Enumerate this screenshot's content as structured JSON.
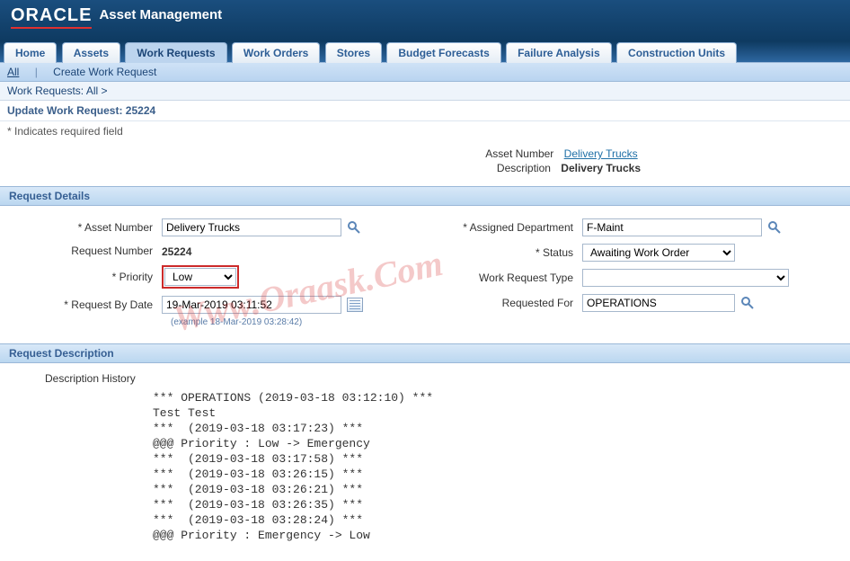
{
  "header": {
    "logo": "ORACLE",
    "app_title": "Asset Management"
  },
  "tabs": {
    "items": [
      "Home",
      "Assets",
      "Work Requests",
      "Work Orders",
      "Stores",
      "Budget Forecasts",
      "Failure Analysis",
      "Construction Units"
    ],
    "active": "Work Requests"
  },
  "subtabs": {
    "items": [
      "All",
      "Create Work Request"
    ],
    "active": "All"
  },
  "breadcrumb": {
    "text": "Work Requests: All  >"
  },
  "page_title": "Update Work Request: 25224",
  "required_note": "Indicates required field",
  "asset_summary": {
    "asset_number_label": "Asset Number",
    "asset_number_value": "Delivery Trucks",
    "description_label": "Description",
    "description_value": "Delivery Trucks"
  },
  "sections": {
    "details": "Request Details",
    "description": "Request Description"
  },
  "form": {
    "asset_number": {
      "label": "Asset Number",
      "value": "Delivery Trucks"
    },
    "request_number": {
      "label": "Request Number",
      "value": "25224"
    },
    "priority": {
      "label": "Priority",
      "value": "Low"
    },
    "request_by_date": {
      "label": "Request By Date",
      "value": "19-Mar-2019 03:11:52",
      "example": "(example 18-Mar-2019 03:28:42)"
    },
    "assigned_department": {
      "label": "Assigned Department",
      "value": "F-Maint"
    },
    "status": {
      "label": "Status",
      "value": "Awaiting Work Order"
    },
    "work_request_type": {
      "label": "Work Request Type",
      "value": ""
    },
    "requested_for": {
      "label": "Requested For",
      "value": "OPERATIONS"
    }
  },
  "description": {
    "label": "Description History",
    "lines": [
      "*** OPERATIONS (2019-03-18 03:12:10) ***",
      "Test Test",
      "***  (2019-03-18 03:17:23) ***",
      "@@@ Priority : Low -> Emergency",
      "***  (2019-03-18 03:17:58) ***",
      "***  (2019-03-18 03:26:15) ***",
      "***  (2019-03-18 03:26:21) ***",
      "***  (2019-03-18 03:26:35) ***",
      "***  (2019-03-18 03:28:24) ***",
      "@@@ Priority : Emergency -> Low"
    ]
  },
  "watermark": "Www.Oraask.Com"
}
